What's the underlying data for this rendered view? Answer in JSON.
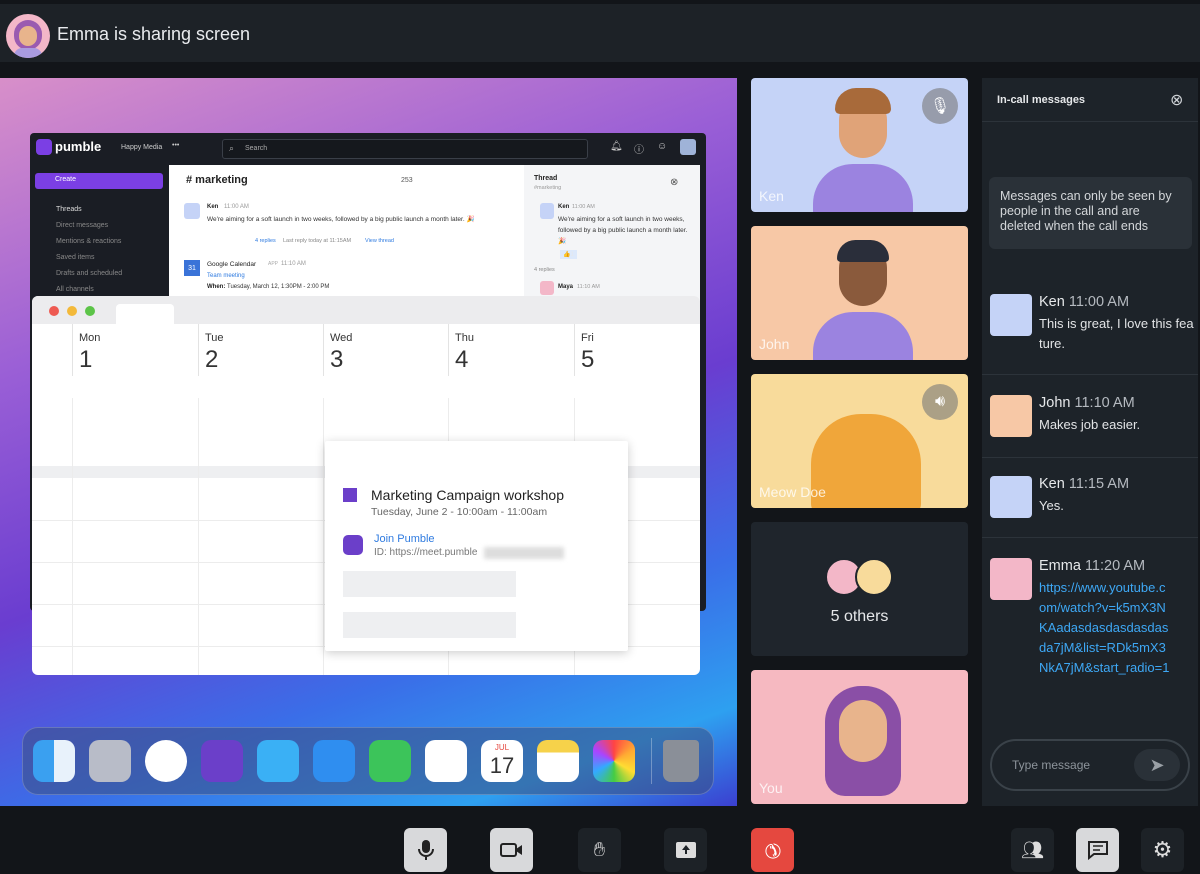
{
  "header": {
    "title": "Emma is sharing screen"
  },
  "shared_screen": {
    "pumble": {
      "logo": "pumble",
      "workspace": "Happy Media",
      "more": "•••",
      "search_placeholder": "Search",
      "create": "Create",
      "sidebar": [
        "Threads",
        "Direct messages",
        "Mentions & reactions",
        "Saved items",
        "Drafts and scheduled",
        "All channels"
      ],
      "channel": "# marketing",
      "member_count": "253",
      "messages": [
        {
          "author": "Ken",
          "time": "11:00 AM",
          "text": "We're aiming for a soft launch in two weeks, followed by a big public launch a month later. 🎉",
          "replies": "4 replies",
          "last_reply": "Last reply today at 11:15AM",
          "view_thread": "View thread"
        },
        {
          "author": "Google Calendar",
          "badge": "APP",
          "time": "11:10 AM",
          "link": "Team meeting",
          "when_label": "When:",
          "when": "Tuesday, March 12, 1:30PM - 2:00 PM"
        }
      ],
      "thread": {
        "title": "Thread",
        "channel": "#marketing",
        "author": "Ken",
        "time": "11:00 AM",
        "text": "We're aiming for a soft launch in two weeks, followed by a big public launch a month later. 🎉",
        "reaction": "👍1",
        "replies": "4 replies",
        "reply_author": "Maya",
        "reply_time": "11:10 AM"
      }
    },
    "calendar": {
      "days": [
        {
          "name": "Mon",
          "num": "1"
        },
        {
          "name": "Tue",
          "num": "2"
        },
        {
          "name": "Wed",
          "num": "3"
        },
        {
          "name": "Thu",
          "num": "4"
        },
        {
          "name": "Fri",
          "num": "5"
        }
      ],
      "event": {
        "title": "Marketing Campaign workshop",
        "time": "Tuesday, June 2 - 10:00am - 11:00am",
        "join": "Join Pumble",
        "id": "ID: https://meet.pumble",
        "color": "#6b3fc9"
      }
    },
    "dock": {
      "calendar_month": "JUL",
      "calendar_day": "17",
      "apps": [
        "finder",
        "launchpad",
        "safari",
        "pumble",
        "messages",
        "mail",
        "facetime",
        "reminders",
        "calendar",
        "notes",
        "photos",
        "trash"
      ]
    }
  },
  "participants": [
    {
      "name": "Ken",
      "bg": "#c5d3f7",
      "status_icon": "mic-muted-icon"
    },
    {
      "name": "John",
      "bg": "#f7c8a6"
    },
    {
      "name": "Meow Doe",
      "bg": "#f8db9b",
      "status_icon": "speaker-icon"
    },
    {
      "name": "5 others",
      "bg": "#1f252c"
    },
    {
      "name": "You",
      "bg": "#f6b9c1"
    }
  ],
  "chat": {
    "title": "In-call messages",
    "notice": "Messages can only be seen by people in the call and are deleted when the call ends",
    "messages": [
      {
        "author": "Ken",
        "time": "11:00 AM",
        "text": "This is great, I love this feature."
      },
      {
        "author": "John",
        "time": "11:10 AM",
        "text": "Makes job easier."
      },
      {
        "author": "Ken",
        "time": "11:15 AM",
        "text": "Yes."
      },
      {
        "author": "Emma",
        "time": "11:20 AM",
        "text": "https://www.youtube.com/watch?v=k5mX3NKAadasdasdasdasdasda7jM&list=RDk5mX3NkA7jM&start_radio=1"
      }
    ],
    "input_placeholder": "Type message"
  },
  "controls": [
    "microphone",
    "camera",
    "raise-hand",
    "share-screen",
    "end-call",
    "participants",
    "chat",
    "settings"
  ],
  "colors": {
    "end_call": "#e5483f",
    "link": "#3ea8f5",
    "accent": "#7b3fe4"
  }
}
